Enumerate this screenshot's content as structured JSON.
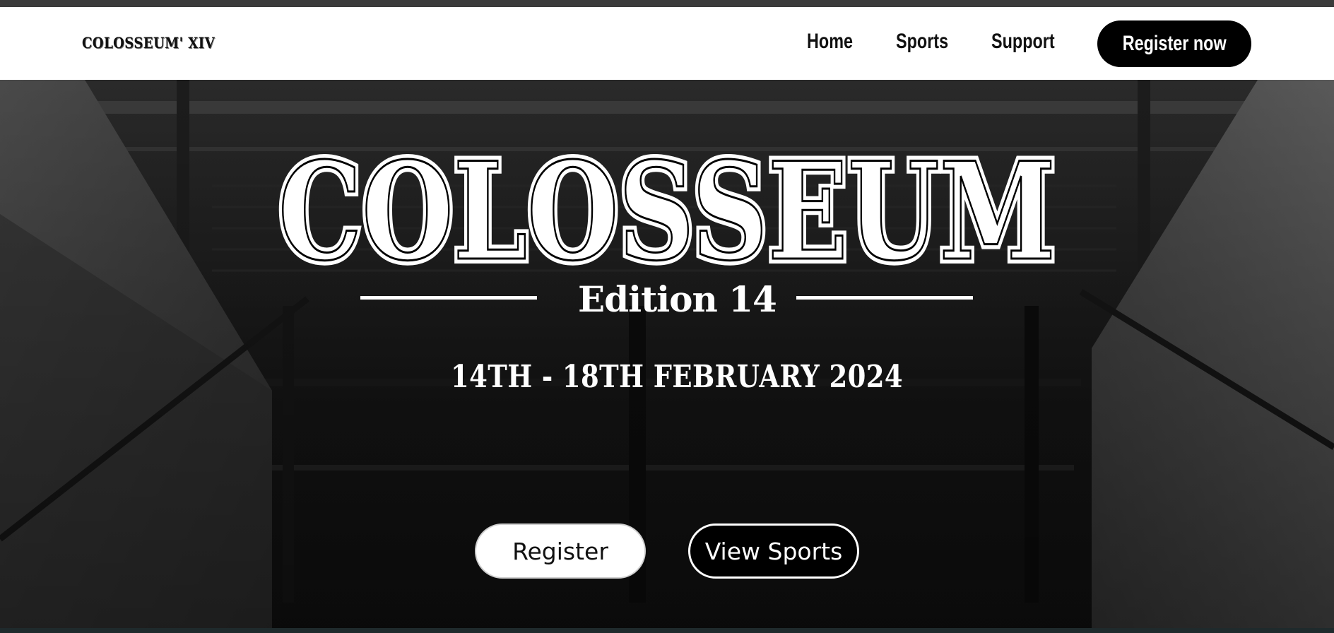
{
  "brand": {
    "name": "COLOSSEUM' XIV"
  },
  "nav": {
    "items": [
      {
        "label": "Home"
      },
      {
        "label": "Sports"
      },
      {
        "label": "Support"
      }
    ],
    "cta_label": "Register now"
  },
  "hero": {
    "title": "COLOSSEUM",
    "edition": "Edition 14",
    "dates": "14TH - 18TH FEBRUARY 2024",
    "primary_button": "Register",
    "secondary_button": "View Sports",
    "background": "grayscale stadium stairway photo"
  },
  "colors": {
    "navbar_bg": "#ffffff",
    "text_dark": "#111111",
    "hero_text": "#ffffff",
    "button_dark": "#000000"
  }
}
